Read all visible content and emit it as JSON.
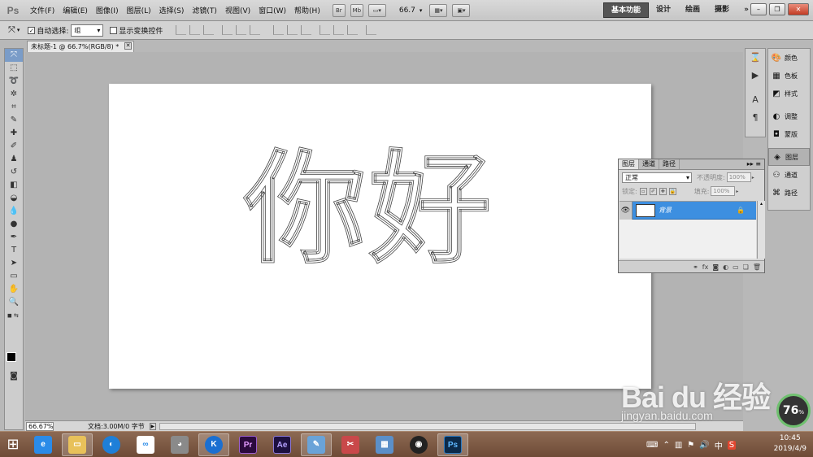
{
  "app": {
    "logo": "Ps"
  },
  "menus": [
    "文件(F)",
    "编辑(E)",
    "图像(I)",
    "图层(L)",
    "选择(S)",
    "滤镜(T)",
    "视图(V)",
    "窗口(W)",
    "帮助(H)"
  ],
  "menubar_buttons": {
    "bridge": "Br",
    "minibridge": "Mb",
    "zoom": "66.7"
  },
  "workspaces": [
    "基本功能",
    "设计",
    "绘画",
    "摄影"
  ],
  "workspace_more": "»",
  "options": {
    "auto_select_label": "自动选择:",
    "auto_select_checked": true,
    "auto_select_value": "组",
    "show_transform_label": "显示变换控件",
    "show_transform_checked": false
  },
  "document": {
    "tab_title": "未标题-1 @ 66.7%(RGB/8) *",
    "canvas_text": "你好"
  },
  "status": {
    "zoom": "66.67%",
    "doc_info": "文档:3.00M/0 字节"
  },
  "panels": {
    "right_column": [
      {
        "label": "颜色",
        "icon": "palette-icon"
      },
      {
        "label": "色板",
        "icon": "swatches-icon"
      },
      {
        "label": "样式",
        "icon": "styles-icon"
      },
      {
        "label": "调整",
        "icon": "adjustments-icon"
      },
      {
        "label": "蒙版",
        "icon": "masks-icon"
      },
      {
        "label": "图层",
        "icon": "layers-icon",
        "active": true
      },
      {
        "label": "通道",
        "icon": "channels-icon"
      },
      {
        "label": "路径",
        "icon": "paths-icon"
      }
    ],
    "layers": {
      "tabs": [
        "图层",
        "通道",
        "路径"
      ],
      "blend_mode": "正常",
      "opacity_label": "不透明度:",
      "opacity_value": "100%",
      "lock_label": "锁定:",
      "fill_label": "填充:",
      "fill_value": "100%",
      "layer_name": "背景"
    }
  },
  "watermark": {
    "logo": "Bai du 经验",
    "url": "jingyan.baidu.com"
  },
  "speed_badge": {
    "value": "76",
    "unit": "%"
  },
  "tray": {
    "ime": "中",
    "ime2": "S"
  },
  "clock": {
    "time": "10:45",
    "date": "2019/4/9"
  },
  "colors": {
    "accent": "#3d8fe0",
    "taskbar": "#7a5740",
    "workspace_active": "#555555"
  }
}
